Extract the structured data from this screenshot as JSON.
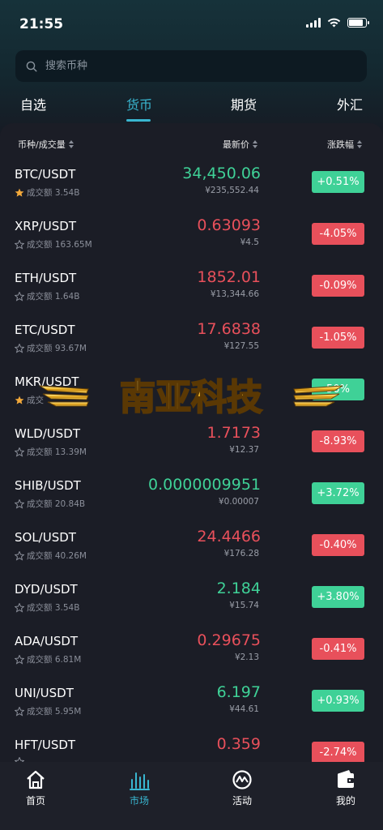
{
  "status": {
    "time": "21:55"
  },
  "search": {
    "placeholder": "搜索币种"
  },
  "tabs": [
    {
      "label": "自选"
    },
    {
      "label": "货币"
    },
    {
      "label": "期货"
    },
    {
      "label": "外汇"
    }
  ],
  "active_tab": 1,
  "table_header": {
    "pair": "币种/成交量",
    "price": "最新价",
    "change": "涨跌幅"
  },
  "rows": [
    {
      "pair": "BTC/USDT",
      "starred": true,
      "volume": "成交额 3.54B",
      "price": "34,450.06",
      "cny": "¥235,552.44",
      "change": "+0.51%",
      "dir": "up"
    },
    {
      "pair": "XRP/USDT",
      "starred": false,
      "volume": "成交额 163.65M",
      "price": "0.63093",
      "cny": "¥4.5",
      "change": "-4.05%",
      "dir": "down"
    },
    {
      "pair": "ETH/USDT",
      "starred": false,
      "volume": "成交额 1.64B",
      "price": "1852.01",
      "cny": "¥13,344.66",
      "change": "-0.09%",
      "dir": "down"
    },
    {
      "pair": "ETC/USDT",
      "starred": false,
      "volume": "成交额 93.67M",
      "price": "17.6838",
      "cny": "¥127.55",
      "change": "-1.05%",
      "dir": "down"
    },
    {
      "pair": "MKR/USDT",
      "starred": true,
      "volume": "成交",
      "price": "",
      "cny": "",
      "change": "50%",
      "dir": "up"
    },
    {
      "pair": "WLD/USDT",
      "starred": false,
      "volume": "成交额 13.39M",
      "price": "1.7173",
      "cny": "¥12.37",
      "change": "-8.93%",
      "dir": "down"
    },
    {
      "pair": "SHIB/USDT",
      "starred": false,
      "volume": "成交额 20.84B",
      "price": "0.0000009951",
      "cny": "¥0.00007",
      "change": "+3.72%",
      "dir": "up"
    },
    {
      "pair": "SOL/USDT",
      "starred": false,
      "volume": "成交额 40.26M",
      "price": "24.4466",
      "cny": "¥176.28",
      "change": "-0.40%",
      "dir": "down"
    },
    {
      "pair": "DYD/USDT",
      "starred": false,
      "volume": "成交额 3.54B",
      "price": "2.184",
      "cny": "¥15.74",
      "change": "+3.80%",
      "dir": "up"
    },
    {
      "pair": "ADA/USDT",
      "starred": false,
      "volume": "成交额 6.81M",
      "price": "0.29675",
      "cny": "¥2.13",
      "change": "-0.41%",
      "dir": "down"
    },
    {
      "pair": "UNI/USDT",
      "starred": false,
      "volume": "成交额 5.95M",
      "price": "6.197",
      "cny": "¥44.61",
      "change": "+0.93%",
      "dir": "up"
    },
    {
      "pair": "HFT/USDT",
      "starred": false,
      "volume": "",
      "price": "0.359",
      "cny": "",
      "change": "-2.74%",
      "dir": "down"
    }
  ],
  "watermark": {
    "text": "南亚科技"
  },
  "bottom_nav": [
    {
      "label": "首页",
      "icon": "home-icon"
    },
    {
      "label": "市场",
      "icon": "market-chart-icon"
    },
    {
      "label": "活动",
      "icon": "activity-icon"
    },
    {
      "label": "我的",
      "icon": "wallet-icon"
    }
  ],
  "active_nav": 1,
  "colors": {
    "accent": "#39b6d0",
    "up": "#3fd197",
    "down": "#e8505b",
    "background": "#1a1c24"
  }
}
